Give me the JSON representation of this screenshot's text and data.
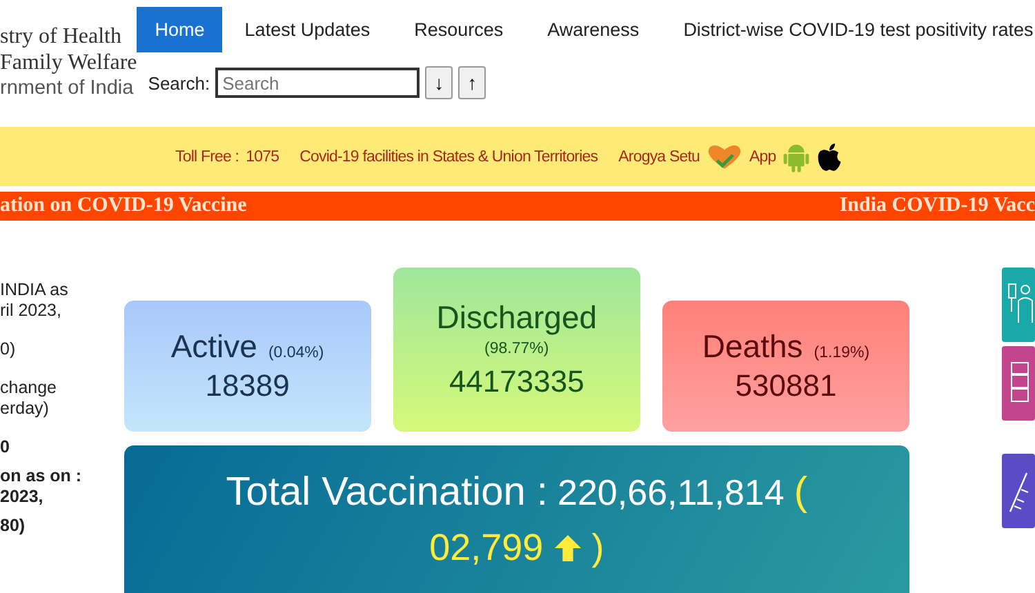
{
  "header": {
    "ministry_lines": [
      "stry of Health",
      "Family Welfare",
      "rnment of India"
    ],
    "nav": [
      {
        "label": "Home",
        "selected": true
      },
      {
        "label": "Latest Updates",
        "selected": false
      },
      {
        "label": "Resources",
        "selected": false
      },
      {
        "label": "Awareness",
        "selected": false
      },
      {
        "label": "District-wise COVID-19 test positivity rates",
        "selected": false
      }
    ],
    "search": {
      "label": "Search:",
      "placeholder": "Search"
    },
    "search_buttons": [
      "↓",
      "↑"
    ]
  },
  "info_bar": {
    "toll_free_label": "Toll Free :",
    "toll_free_number": "1075",
    "facilities_link": "Covid-19 facilities in States & Union Territories",
    "app_name": "Arogya Setu",
    "app_word": "App"
  },
  "ticker": [
    "ation on COVID-19 Vaccine",
    "India COVID-19 Vacc"
  ],
  "left_panel": [
    {
      "lines": [
        "INDIA as",
        "ril 2023,"
      ],
      "bold": false
    },
    {
      "lines": [
        "0)"
      ],
      "bold": false
    },
    {
      "lines": [
        "change",
        "erday)"
      ],
      "bold": false
    },
    {
      "lines": [
        "0"
      ],
      "bold": true
    },
    {
      "lines": [
        "on as on :",
        "2023,"
      ],
      "bold": true
    },
    {
      "lines": [
        "80)"
      ],
      "bold": true
    }
  ],
  "stats": [
    {
      "kind": "active",
      "label": "Active",
      "percent": "(0.04%)",
      "value": "18389"
    },
    {
      "kind": "discharged",
      "label": "Discharged",
      "percent": "(98.77%)",
      "value": "44173335"
    },
    {
      "kind": "deaths",
      "label": "Deaths",
      "percent": "(1.19%)",
      "value": "530881"
    }
  ],
  "vaccination": {
    "label": "Total Vaccination :",
    "total": "220,66,11,814",
    "open": "(",
    "change": "02,799",
    "close": ")"
  }
}
